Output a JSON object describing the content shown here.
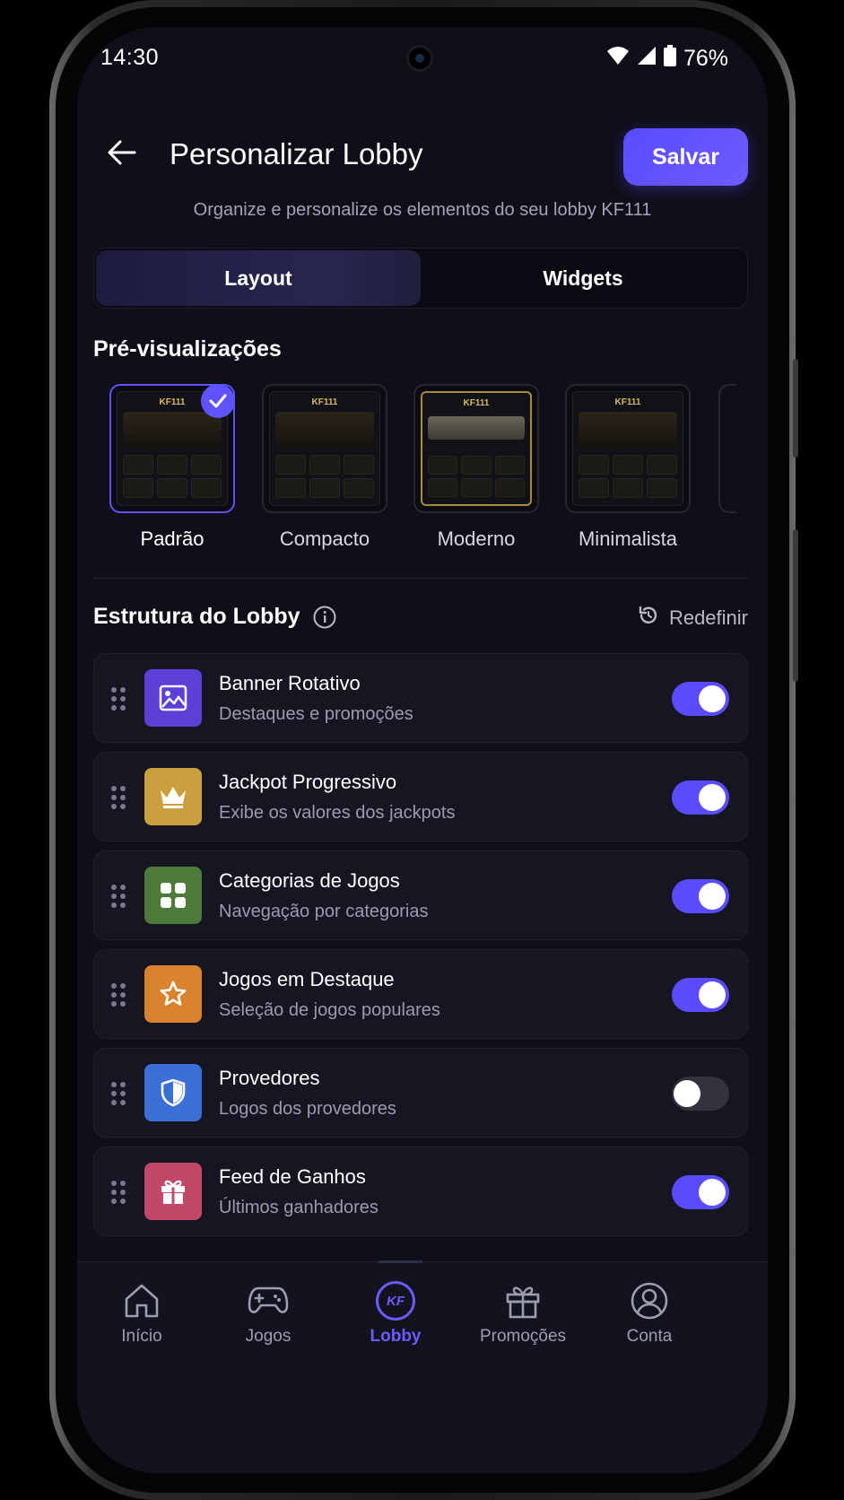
{
  "status": {
    "time": "14:30",
    "battery": "76%"
  },
  "header": {
    "title": "Personalizar Lobby",
    "save_label": "Salvar",
    "subtitle": "Organize e personalize os elementos do seu lobby KF111"
  },
  "tabs": [
    {
      "label": "Layout",
      "active": true
    },
    {
      "label": "Widgets",
      "active": false
    }
  ],
  "previews": {
    "title": "Pré-visualizações",
    "items": [
      {
        "label": "Padrão",
        "brand": "KF111",
        "selected": true
      },
      {
        "label": "Compacto",
        "brand": "KF111",
        "selected": false
      },
      {
        "label": "Moderno",
        "brand": "KF111",
        "selected": false
      },
      {
        "label": "Minimalista",
        "brand": "KF111",
        "selected": false
      }
    ]
  },
  "structure": {
    "title": "Estrutura do Lobby",
    "reset_label": "Redefinir",
    "items": [
      {
        "title": "Banner Rotativo",
        "subtitle": "Destaques e promoções",
        "icon": "image-icon",
        "color": "#5b3fd6",
        "enabled": true
      },
      {
        "title": "Jackpot Progressivo",
        "subtitle": "Exibe os valores dos jackpots",
        "icon": "crown-icon",
        "color": "#c9a03d",
        "enabled": true
      },
      {
        "title": "Categorias de Jogos",
        "subtitle": "Navegação por categorias",
        "icon": "grid-icon",
        "color": "#4b7a3a",
        "enabled": true
      },
      {
        "title": "Jogos em Destaque",
        "subtitle": "Seleção de jogos populares",
        "icon": "star-icon",
        "color": "#d9832f",
        "enabled": true
      },
      {
        "title": "Provedores",
        "subtitle": "Logos dos provedores",
        "icon": "shield-icon",
        "color": "#3b6fd6",
        "enabled": false
      },
      {
        "title": "Feed de Ganhos",
        "subtitle": "Últimos ganhadores",
        "icon": "gift-icon",
        "color": "#c2486a",
        "enabled": true
      }
    ]
  },
  "nav": {
    "items": [
      {
        "label": "Início",
        "icon": "home-icon"
      },
      {
        "label": "Jogos",
        "icon": "gamepad-icon"
      },
      {
        "label": "Lobby",
        "icon": "kf-logo-icon",
        "badge": "KF",
        "active": true
      },
      {
        "label": "Promoções",
        "icon": "gift-icon"
      },
      {
        "label": "Conta",
        "icon": "user-icon"
      }
    ]
  },
  "colors": {
    "accent": "#5a4bff",
    "background": "#0f0f1a",
    "card": "#161622"
  }
}
